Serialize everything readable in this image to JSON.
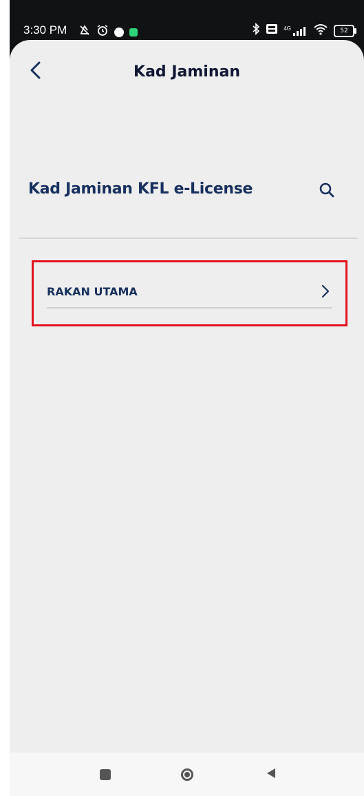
{
  "status_bar": {
    "time": "3:30 PM",
    "battery": "52",
    "network": "4G",
    "icons": [
      "mute-icon",
      "alarm-icon",
      "app-notification-icon",
      "app-notification-icon",
      "bluetooth-icon",
      "volte-icon",
      "signal-icon",
      "wifi-icon",
      "battery-icon"
    ]
  },
  "header": {
    "title": "Kad Jaminan",
    "back_icon": "chevron-left-icon"
  },
  "section": {
    "title": "Kad Jaminan KFL e-License",
    "search_icon": "search-icon"
  },
  "list": {
    "items": [
      {
        "label": "RAKAN UTAMA",
        "icon": "chevron-right-icon"
      }
    ]
  },
  "highlight": {
    "color": "#e2111c"
  },
  "colors": {
    "title_text": "#0f1734",
    "accent_text": "#17305e",
    "background": "#eeeeef"
  },
  "nav_bar": {
    "buttons": [
      "recents-button",
      "home-button",
      "back-button"
    ]
  }
}
